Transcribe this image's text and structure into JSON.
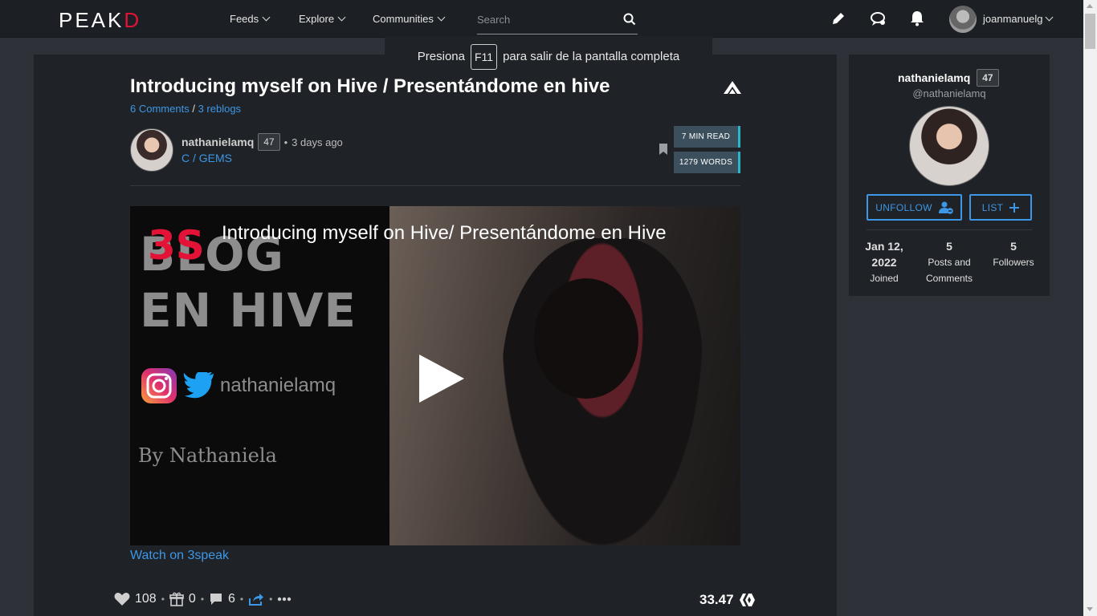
{
  "brand": {
    "logo_text": "PEAK",
    "logo_accent": "D",
    "accent_color": "#e31337",
    "link_color": "#3d97e6"
  },
  "nav": {
    "items": [
      {
        "label": "Feeds"
      },
      {
        "label": "Explore"
      },
      {
        "label": "Communities"
      }
    ],
    "search_placeholder": "Search",
    "user": "joanmanuelg"
  },
  "toast": {
    "prefix": "Presiona",
    "key": "F11",
    "suffix": "para salir de la pantalla completa"
  },
  "post": {
    "title": "Introducing myself on Hive / Presentándome en hive",
    "comments_link": "6 Comments",
    "separator": "/",
    "reblogs_link": "3 reblogs",
    "author": "nathanielamq",
    "reputation": "47",
    "time_sep": "•",
    "time": "3 days ago",
    "community": "C / GEMS",
    "read_time": "7 MIN READ",
    "word_count": "1279 WORDS",
    "video": {
      "title": "Introducing myself on Hive/ Presentándome en Hive",
      "logo": "3S",
      "line1": "BLOG",
      "line2": "EN HIVE",
      "handle": "nathanielamq",
      "by": "By Nathaniela"
    },
    "watch_link": "Watch on 3speak"
  },
  "actions": {
    "votes": "108",
    "gifts": "0",
    "comments": "6",
    "dot": "•",
    "payout": "33.47"
  },
  "profile": {
    "name": "nathanielamq",
    "reputation": "47",
    "handle": "@nathanielamq",
    "unfollow_label": "UNFOLLOW",
    "list_label": "LIST",
    "stats": [
      {
        "value": "Jan 12,",
        "value2": "2022",
        "label": "Joined"
      },
      {
        "value": "5",
        "label": "Posts and",
        "label2": "Comments"
      },
      {
        "value": "5",
        "label": "Followers"
      }
    ]
  }
}
